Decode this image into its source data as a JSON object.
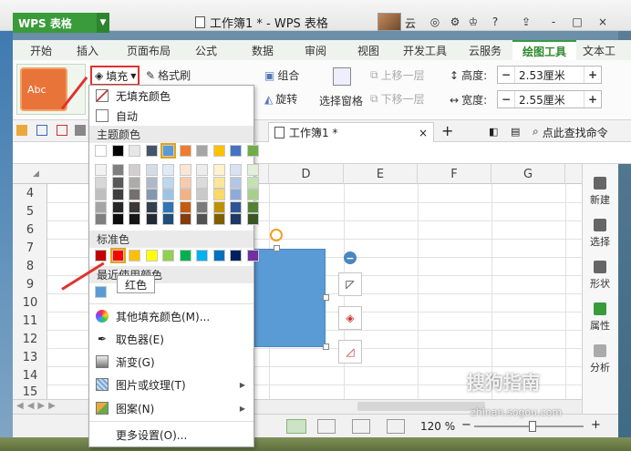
{
  "app": {
    "logo": "WPS 表格",
    "title": "工作簿1 * - WPS 表格",
    "user": "云"
  },
  "titlebar_buttons": [
    "?",
    "-",
    "□",
    "×"
  ],
  "menu_tabs": [
    "开始",
    "插入",
    "页面布局",
    "公式",
    "数据",
    "审阅",
    "视图",
    "开发工具",
    "云服务",
    "绘图工具",
    "文本工"
  ],
  "active_tab": "绘图工具",
  "ribbon": {
    "style_preview": "Abc",
    "fill_label": "填充",
    "format_brush": "格式刷",
    "group": "组合",
    "rotate": "旋转",
    "select_pane": "选择窗格",
    "bring_forward": "上移一层",
    "send_backward": "下移一层",
    "height_label": "高度:",
    "height_value": "2.53厘米",
    "width_label": "宽度:",
    "width_value": "2.55厘米"
  },
  "doc_tab": "工作簿1 *",
  "search_cmd": "点此查找命令",
  "columns": [
    "D",
    "E",
    "F",
    "G"
  ],
  "rows": [
    "4",
    "5",
    "6",
    "7",
    "8",
    "9",
    "10",
    "11",
    "12",
    "13",
    "14",
    "15"
  ],
  "right_panel": [
    "新建",
    "选择",
    "形状",
    "属性",
    "分析"
  ],
  "status": {
    "zoom": "120 %"
  },
  "dropdown": {
    "no_fill": "无填充颜色",
    "auto": "自动",
    "theme_colors": "主题颜色",
    "standard_colors": "标准色",
    "recent_colors": "最近使用颜色",
    "more_fill": "其他填充颜色(M)...",
    "eyedropper": "取色器(E)",
    "gradient": "渐变(G)",
    "picture_texture": "图片或纹理(T)",
    "pattern": "图案(N)",
    "more_settings": "更多设置(O)...",
    "tooltip": "红色"
  },
  "colors": {
    "theme_top": [
      "#ffffff",
      "#000000",
      "#e7e6e6",
      "#44546a",
      "#5b9bd5",
      "#ed7d31",
      "#a5a5a5",
      "#ffc000",
      "#4472c4",
      "#70ad47"
    ],
    "theme_shades": [
      [
        "#f2f2f2",
        "#7f7f7f",
        "#d0cece",
        "#d6dce4",
        "#deebf6",
        "#fbe5d5",
        "#ededed",
        "#fff2cc",
        "#d9e2f3",
        "#e2efd9"
      ],
      [
        "#d8d8d8",
        "#595959",
        "#aeabab",
        "#adb9ca",
        "#bdd7ee",
        "#f7cbac",
        "#dbdbdb",
        "#fee599",
        "#b4c6e7",
        "#c5e0b3"
      ],
      [
        "#bfbfbf",
        "#3f3f3f",
        "#757070",
        "#8496b0",
        "#9cc3e5",
        "#f4b183",
        "#c9c9c9",
        "#ffd965",
        "#8eaadb",
        "#a8d08d"
      ],
      [
        "#a5a5a5",
        "#262626",
        "#3a3838",
        "#323f4f",
        "#2e75b5",
        "#c55a11",
        "#7b7b7b",
        "#bf9000",
        "#2f5496",
        "#538135"
      ],
      [
        "#7f7f7f",
        "#0c0c0c",
        "#171616",
        "#222a35",
        "#1e4e79",
        "#833c0b",
        "#525252",
        "#7f6000",
        "#1f3864",
        "#375623"
      ]
    ],
    "standard": [
      "#c00000",
      "#ff0000",
      "#ffc000",
      "#ffff00",
      "#92d050",
      "#00b050",
      "#00b0f0",
      "#0070c0",
      "#002060",
      "#7030a0"
    ],
    "recent": [
      "#5b9bd5"
    ]
  },
  "watermark": {
    "text": "搜狗指南",
    "url": "zhinan.sogou.com"
  }
}
